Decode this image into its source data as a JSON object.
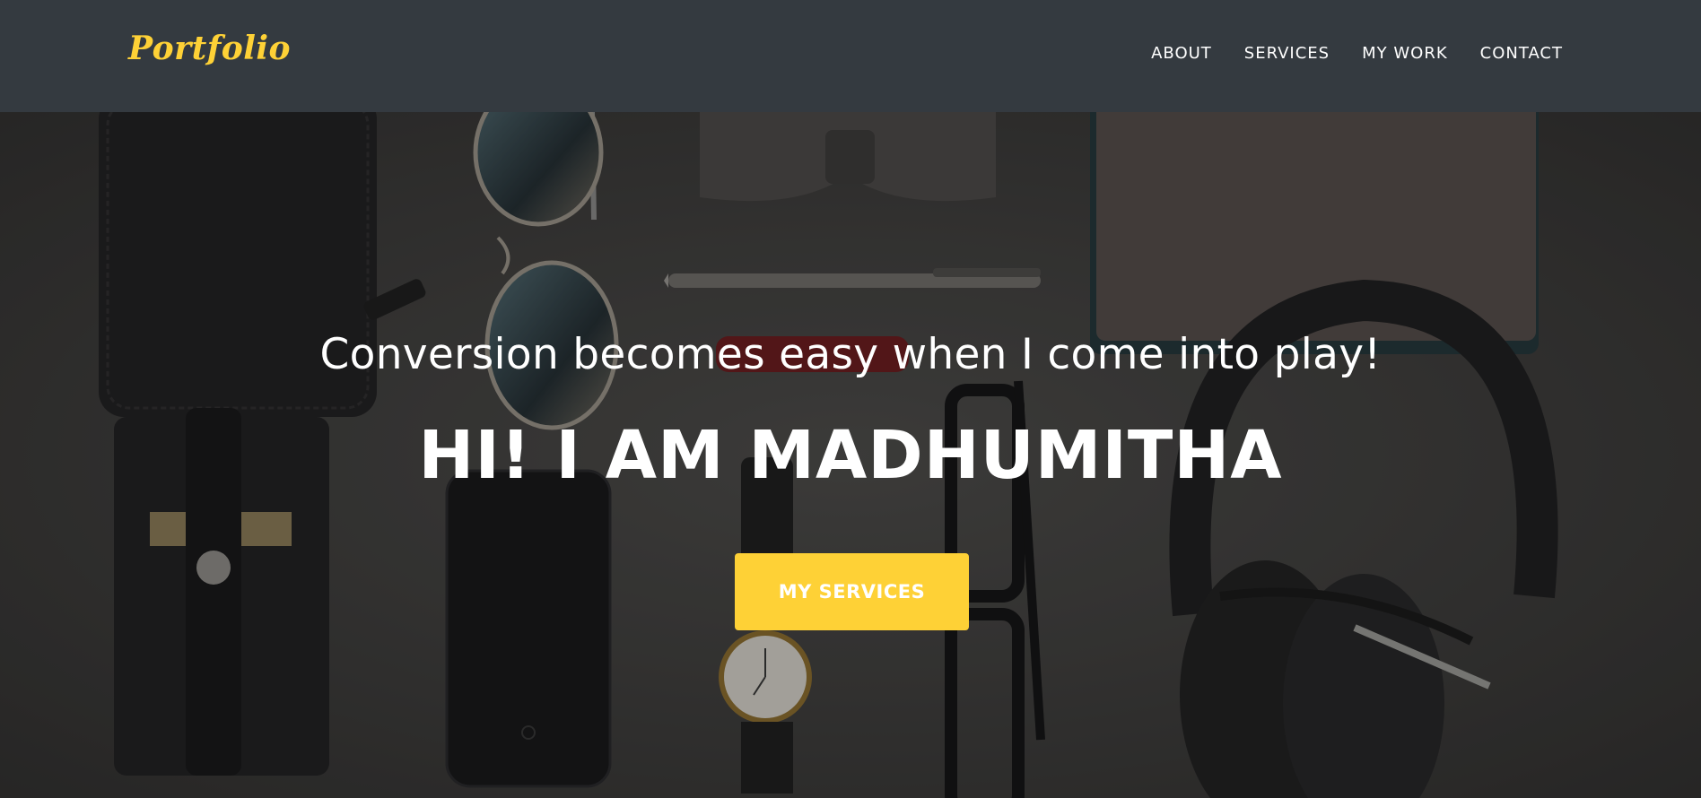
{
  "navbar": {
    "brand": "Portfolio",
    "links": [
      "ABOUT",
      "SERVICES",
      "MY WORK",
      "CONTACT"
    ]
  },
  "hero": {
    "tagline": "Conversion becomes easy when I come into play!",
    "headline": "HI! I AM MADHUMITHA",
    "cta_label": "MY SERVICES"
  },
  "colors": {
    "navbar_bg": "#343a40",
    "accent": "#fed136",
    "text": "#ffffff"
  }
}
